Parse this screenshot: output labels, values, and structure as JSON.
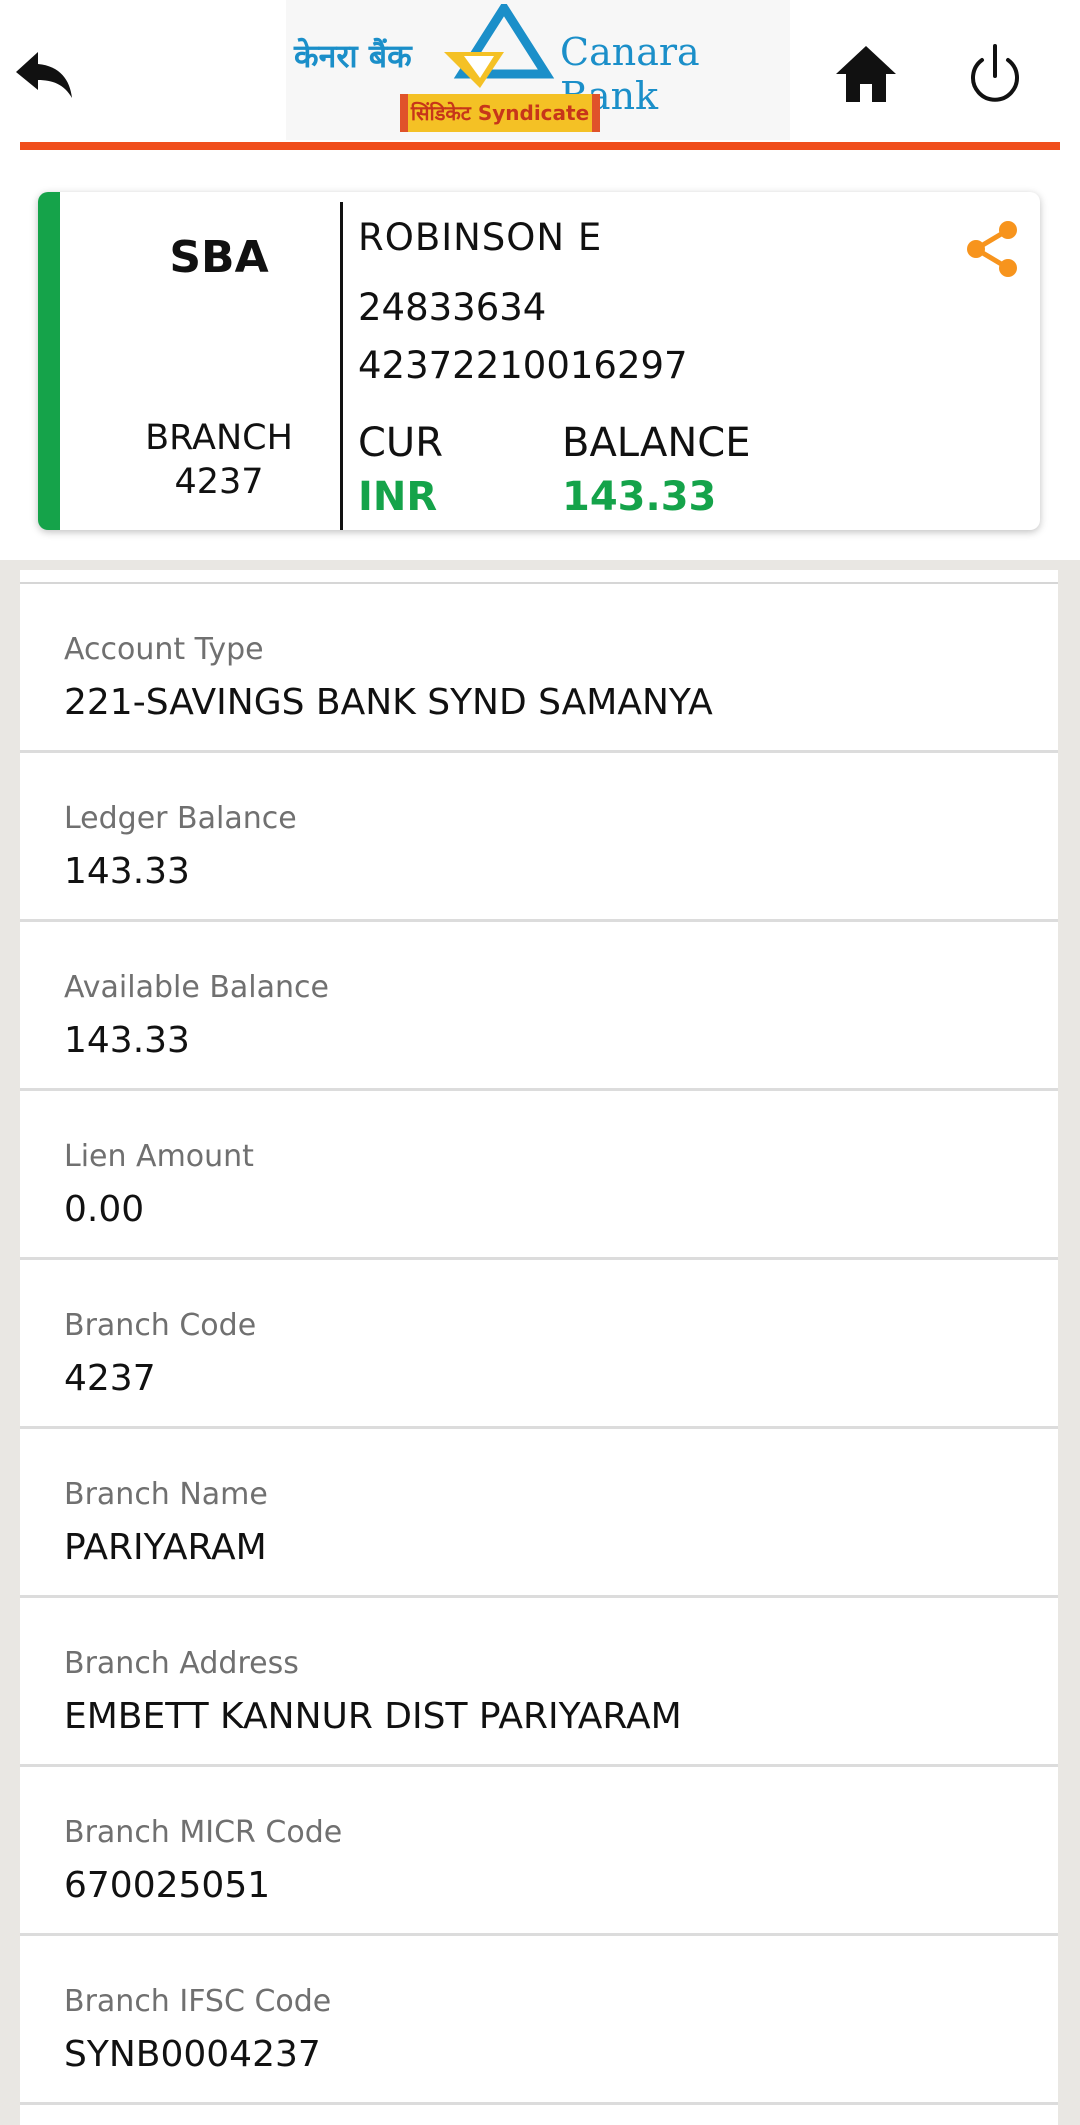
{
  "header": {
    "bank_name_hindi": "केनरा बैंक",
    "bank_name": "Canara Bank",
    "sub_brand": "सिंडिकेट Syndicate",
    "colors": {
      "accent": "#f04e1c",
      "logo_blue": "#1b8fc9"
    }
  },
  "account_card": {
    "type": "SBA",
    "branch_label": "BRANCH",
    "branch_number": "4237",
    "holder_name": "ROBINSON  E",
    "customer_id": "24833634",
    "account_number": "42372210016297",
    "currency_label": "CUR",
    "currency_value": "INR",
    "balance_label": "BALANCE",
    "balance_value": "143.33",
    "colors": {
      "highlight": "#15a34a",
      "share": "#f7941d"
    }
  },
  "details": [
    {
      "label": "Account Type",
      "value": "221-SAVINGS BANK SYND SAMANYA"
    },
    {
      "label": "Ledger Balance",
      "value": "143.33"
    },
    {
      "label": "Available Balance",
      "value": "143.33"
    },
    {
      "label": "Lien Amount",
      "value": "0.00"
    },
    {
      "label": "Branch Code",
      "value": "4237"
    },
    {
      "label": "Branch Name",
      "value": "PARIYARAM"
    },
    {
      "label": "Branch Address",
      "value": "EMBETT KANNUR DIST  PARIYARAM"
    },
    {
      "label": "Branch MICR Code",
      "value": "670025051"
    },
    {
      "label": "Branch IFSC Code",
      "value": "SYNB0004237"
    }
  ]
}
